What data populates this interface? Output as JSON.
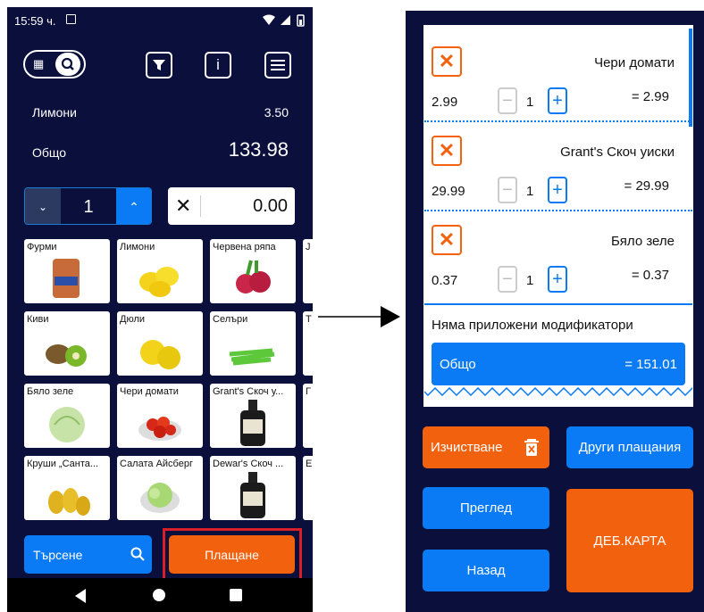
{
  "left": {
    "status": {
      "time": "15:59 ч."
    },
    "receipt": {
      "last_item_name": "Лимони",
      "last_item_price": "3.50",
      "total_label": "Общо",
      "total_value": "133.98"
    },
    "quantity": {
      "value": "1"
    },
    "discount": {
      "value": "0.00"
    },
    "products": [
      {
        "label": "Фурми",
        "icon": "dates-package-icon"
      },
      {
        "label": "Лимони",
        "icon": "lemons-icon"
      },
      {
        "label": "Червена ряпа",
        "icon": "radish-icon"
      },
      {
        "label": "Киви",
        "icon": "kiwi-icon"
      },
      {
        "label": "Дюли",
        "icon": "quince-icon"
      },
      {
        "label": "Селъри",
        "icon": "celery-icon"
      },
      {
        "label": "Бяло зеле",
        "icon": "cabbage-icon"
      },
      {
        "label": "Чери домати",
        "icon": "cherry-tomatoes-icon"
      },
      {
        "label": "Grant's Скоч у...",
        "icon": "whisky-bottle-icon"
      },
      {
        "label": "Круши „Санта...",
        "icon": "pears-icon"
      },
      {
        "label": "Салата Айсберг",
        "icon": "lettuce-icon"
      },
      {
        "label": "Dewar's Скоч ...",
        "icon": "whisky-bottle-icon"
      }
    ],
    "partial_tile_labels": [
      "J",
      "Т",
      "Г",
      "E"
    ],
    "search_label": "Търсене",
    "pay_label": "Плащане"
  },
  "right": {
    "items": [
      {
        "name": "Чери домати",
        "price": "2.99",
        "qty": "1",
        "sum": "= 2.99"
      },
      {
        "name": "Grant's Скоч уиски",
        "price": "29.99",
        "qty": "1",
        "sum": "= 29.99"
      },
      {
        "name": "Бяло зеле",
        "price": "0.37",
        "qty": "1",
        "sum": "= 0.37"
      }
    ],
    "modifiers_text": "Няма приложени модификатори",
    "total_label": "Общо",
    "total_value": "= 151.01",
    "buttons": {
      "clear": "Изчистване",
      "other_payments": "Други плащания",
      "review": "Преглед",
      "back": "Назад",
      "debit_card": "ДЕБ.КАРТА"
    }
  },
  "colors": {
    "bg": "#0a0f3c",
    "blue": "#0a7bf5",
    "orange": "#f2610d",
    "highlight": "#d9202a"
  }
}
